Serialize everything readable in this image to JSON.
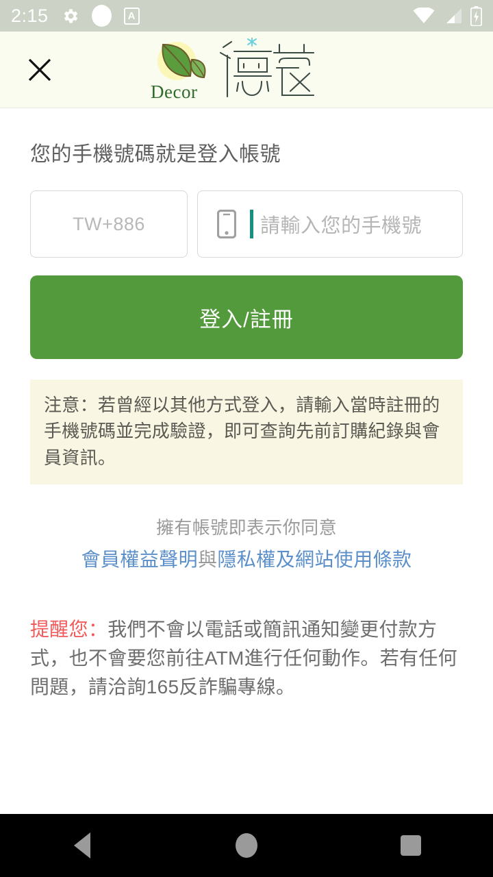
{
  "status_bar": {
    "time": "2:15",
    "left_icons": [
      "gear-icon",
      "circle-icon",
      "a-badge-icon"
    ],
    "a_badge_label": "A",
    "right_icons": [
      "wifi-icon",
      "signal-icon",
      "battery-charging-icon"
    ],
    "background_color": "#ccd2c6"
  },
  "header": {
    "close_label": "×",
    "logo_latin": "Decor",
    "logo_cjk": "億蔻",
    "background_color": "#fafcf0"
  },
  "main": {
    "title": "您的手機號碼就是登入帳號",
    "country_field": {
      "placeholder": "TW+886",
      "value": ""
    },
    "phone_field": {
      "placeholder": "請輸入您的手機號",
      "value": "",
      "icon": "smartphone-icon",
      "caret_color": "#159080"
    },
    "login_button": {
      "label": "登入/註冊",
      "color": "#539a3c"
    },
    "notice": {
      "text": "注意：若曾經以其他方式登入，請輸入當時註冊的手機號碼並完成驗證，即可查詢先前訂購紀錄與會員資訊。",
      "background_color": "#faf6e4"
    },
    "terms": {
      "lead": "擁有帳號即表示你同意",
      "link_1": "會員權益聲明",
      "separator": "與",
      "link_2": "隱私權及網站使用條款",
      "link_color": "#5b8fc9"
    },
    "warning": {
      "highlight": "提醒您：",
      "highlight_color": "#f05a5a",
      "body": "我們不會以電話或簡訊通知變更付款方式，也不會要您前往ATM進行任何動作。若有任何問題，請洽詢165反詐騙專線。"
    }
  },
  "nav_bar": {
    "back": "back-triangle-icon",
    "home": "home-circle-icon",
    "recents": "recents-square-icon"
  }
}
